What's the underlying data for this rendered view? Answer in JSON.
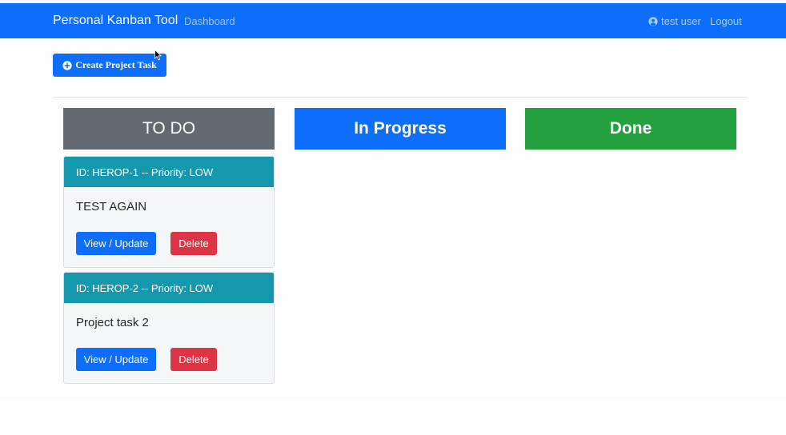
{
  "navbar": {
    "brand": "Personal Kanban Tool",
    "dashboard_link": "Dashboard",
    "user_name": "test user",
    "logout_link": "Logout",
    "user_icon": "user-circle-icon"
  },
  "toolbar": {
    "create_label": "Create Project Task",
    "create_icon": "plus-circle-icon"
  },
  "columns": [
    {
      "title": "TO DO",
      "color": "#636970"
    },
    {
      "title": "In Progress",
      "color": "#0d6efd"
    },
    {
      "title": "Done",
      "color": "#24a03f"
    }
  ],
  "tasks": [
    {
      "header": "ID: HEROP-1 -- Priority: LOW",
      "summary": "TEST AGAIN",
      "view_label": "View / Update",
      "delete_label": "Delete"
    },
    {
      "header": "ID: HEROP-2 -- Priority: LOW",
      "summary": "Project task 2",
      "view_label": "View / Update",
      "delete_label": "Delete"
    }
  ],
  "colors": {
    "primary": "#0d6efd",
    "card_header": "#1597ad",
    "danger": "#dc3545"
  }
}
